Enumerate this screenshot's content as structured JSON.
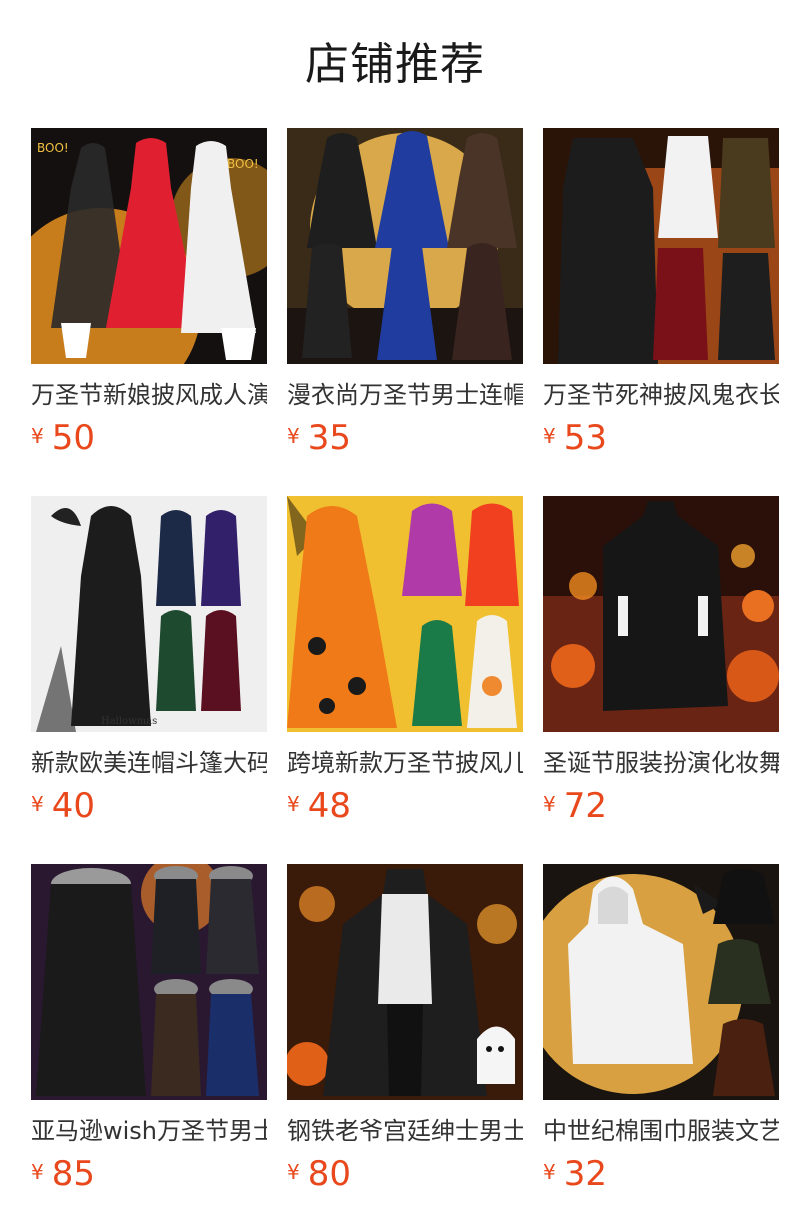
{
  "header": {
    "title": "店铺推荐"
  },
  "products": [
    {
      "name": "万圣节新娘披风成人演出服",
      "currency": "¥",
      "price": "50",
      "image": "bridal-capes-photo",
      "accent": "#f0a020"
    },
    {
      "name": "漫衣尚万圣节男士连帽披风",
      "currency": "¥",
      "price": "35",
      "image": "hooded-cloaks-moon-photo",
      "accent": "#e0a040"
    },
    {
      "name": "万圣节死神披风鬼衣长袍",
      "currency": "¥",
      "price": "53",
      "image": "reaper-robes-photo",
      "accent": "#c05018"
    },
    {
      "name": "新款欧美连帽斗篷大码长袍",
      "currency": "¥",
      "price": "40",
      "image": "moon-print-cloaks-photo",
      "accent": "#e8e8e8"
    },
    {
      "name": "跨境新款万圣节披风儿童斗篷",
      "currency": "¥",
      "price": "48",
      "image": "kids-printed-capes-photo",
      "accent": "#f0c030"
    },
    {
      "name": "圣诞节服装扮演化妆舞会披风",
      "currency": "¥",
      "price": "72",
      "image": "black-cape-pumpkins-photo",
      "accent": "#c04818"
    },
    {
      "name": "亚马逊wish万圣节男士毛领披风",
      "currency": "¥",
      "price": "85",
      "image": "fur-collar-cloaks-photo",
      "accent": "#e07a28"
    },
    {
      "name": "钢铁老爷宫廷绅士男士披风",
      "currency": "¥",
      "price": "80",
      "image": "gentleman-cape-ghost-photo",
      "accent": "#d07a20"
    },
    {
      "name": "中世纪棉围巾服装文艺复兴",
      "currency": "¥",
      "price": "32",
      "image": "medieval-hood-scarf-photo",
      "accent": "#d89a30"
    }
  ]
}
